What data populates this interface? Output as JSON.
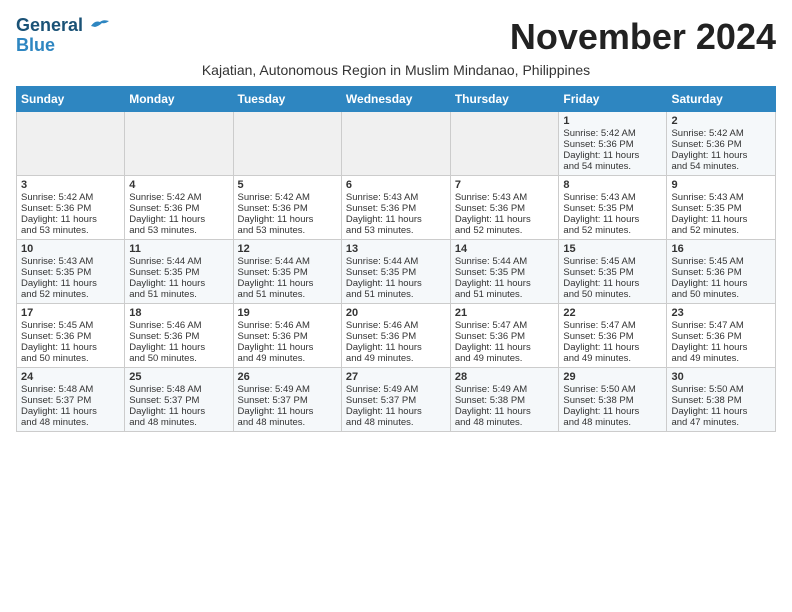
{
  "logo": {
    "line1": "General",
    "line2": "Blue"
  },
  "title": "November 2024",
  "subtitle": "Kajatian, Autonomous Region in Muslim Mindanao, Philippines",
  "headers": [
    "Sunday",
    "Monday",
    "Tuesday",
    "Wednesday",
    "Thursday",
    "Friday",
    "Saturday"
  ],
  "weeks": [
    [
      {
        "day": "",
        "info": ""
      },
      {
        "day": "",
        "info": ""
      },
      {
        "day": "",
        "info": ""
      },
      {
        "day": "",
        "info": ""
      },
      {
        "day": "",
        "info": ""
      },
      {
        "day": "1",
        "info": "Sunrise: 5:42 AM\nSunset: 5:36 PM\nDaylight: 11 hours\nand 54 minutes."
      },
      {
        "day": "2",
        "info": "Sunrise: 5:42 AM\nSunset: 5:36 PM\nDaylight: 11 hours\nand 54 minutes."
      }
    ],
    [
      {
        "day": "3",
        "info": "Sunrise: 5:42 AM\nSunset: 5:36 PM\nDaylight: 11 hours\nand 53 minutes."
      },
      {
        "day": "4",
        "info": "Sunrise: 5:42 AM\nSunset: 5:36 PM\nDaylight: 11 hours\nand 53 minutes."
      },
      {
        "day": "5",
        "info": "Sunrise: 5:42 AM\nSunset: 5:36 PM\nDaylight: 11 hours\nand 53 minutes."
      },
      {
        "day": "6",
        "info": "Sunrise: 5:43 AM\nSunset: 5:36 PM\nDaylight: 11 hours\nand 53 minutes."
      },
      {
        "day": "7",
        "info": "Sunrise: 5:43 AM\nSunset: 5:36 PM\nDaylight: 11 hours\nand 52 minutes."
      },
      {
        "day": "8",
        "info": "Sunrise: 5:43 AM\nSunset: 5:35 PM\nDaylight: 11 hours\nand 52 minutes."
      },
      {
        "day": "9",
        "info": "Sunrise: 5:43 AM\nSunset: 5:35 PM\nDaylight: 11 hours\nand 52 minutes."
      }
    ],
    [
      {
        "day": "10",
        "info": "Sunrise: 5:43 AM\nSunset: 5:35 PM\nDaylight: 11 hours\nand 52 minutes."
      },
      {
        "day": "11",
        "info": "Sunrise: 5:44 AM\nSunset: 5:35 PM\nDaylight: 11 hours\nand 51 minutes."
      },
      {
        "day": "12",
        "info": "Sunrise: 5:44 AM\nSunset: 5:35 PM\nDaylight: 11 hours\nand 51 minutes."
      },
      {
        "day": "13",
        "info": "Sunrise: 5:44 AM\nSunset: 5:35 PM\nDaylight: 11 hours\nand 51 minutes."
      },
      {
        "day": "14",
        "info": "Sunrise: 5:44 AM\nSunset: 5:35 PM\nDaylight: 11 hours\nand 51 minutes."
      },
      {
        "day": "15",
        "info": "Sunrise: 5:45 AM\nSunset: 5:35 PM\nDaylight: 11 hours\nand 50 minutes."
      },
      {
        "day": "16",
        "info": "Sunrise: 5:45 AM\nSunset: 5:36 PM\nDaylight: 11 hours\nand 50 minutes."
      }
    ],
    [
      {
        "day": "17",
        "info": "Sunrise: 5:45 AM\nSunset: 5:36 PM\nDaylight: 11 hours\nand 50 minutes."
      },
      {
        "day": "18",
        "info": "Sunrise: 5:46 AM\nSunset: 5:36 PM\nDaylight: 11 hours\nand 50 minutes."
      },
      {
        "day": "19",
        "info": "Sunrise: 5:46 AM\nSunset: 5:36 PM\nDaylight: 11 hours\nand 49 minutes."
      },
      {
        "day": "20",
        "info": "Sunrise: 5:46 AM\nSunset: 5:36 PM\nDaylight: 11 hours\nand 49 minutes."
      },
      {
        "day": "21",
        "info": "Sunrise: 5:47 AM\nSunset: 5:36 PM\nDaylight: 11 hours\nand 49 minutes."
      },
      {
        "day": "22",
        "info": "Sunrise: 5:47 AM\nSunset: 5:36 PM\nDaylight: 11 hours\nand 49 minutes."
      },
      {
        "day": "23",
        "info": "Sunrise: 5:47 AM\nSunset: 5:36 PM\nDaylight: 11 hours\nand 49 minutes."
      }
    ],
    [
      {
        "day": "24",
        "info": "Sunrise: 5:48 AM\nSunset: 5:37 PM\nDaylight: 11 hours\nand 48 minutes."
      },
      {
        "day": "25",
        "info": "Sunrise: 5:48 AM\nSunset: 5:37 PM\nDaylight: 11 hours\nand 48 minutes."
      },
      {
        "day": "26",
        "info": "Sunrise: 5:49 AM\nSunset: 5:37 PM\nDaylight: 11 hours\nand 48 minutes."
      },
      {
        "day": "27",
        "info": "Sunrise: 5:49 AM\nSunset: 5:37 PM\nDaylight: 11 hours\nand 48 minutes."
      },
      {
        "day": "28",
        "info": "Sunrise: 5:49 AM\nSunset: 5:38 PM\nDaylight: 11 hours\nand 48 minutes."
      },
      {
        "day": "29",
        "info": "Sunrise: 5:50 AM\nSunset: 5:38 PM\nDaylight: 11 hours\nand 48 minutes."
      },
      {
        "day": "30",
        "info": "Sunrise: 5:50 AM\nSunset: 5:38 PM\nDaylight: 11 hours\nand 47 minutes."
      }
    ]
  ]
}
